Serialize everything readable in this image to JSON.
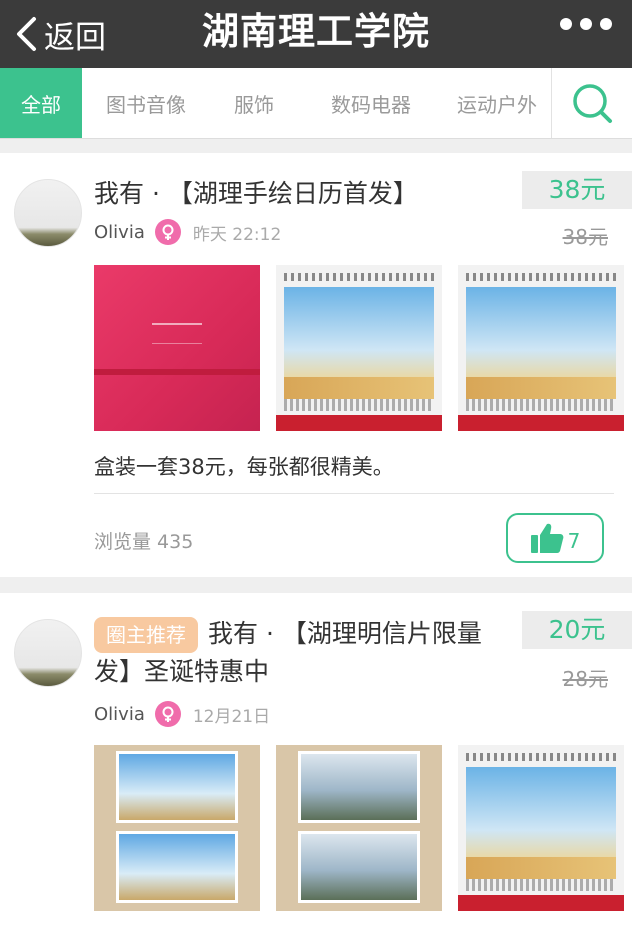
{
  "header": {
    "back_label": "返回",
    "title": "湖南理工学院"
  },
  "tabs": [
    {
      "label": "全部",
      "active": true
    },
    {
      "label": "图书音像"
    },
    {
      "label": "服饰"
    },
    {
      "label": "数码电器"
    },
    {
      "label": "运动户外"
    }
  ],
  "posts": [
    {
      "title": "我有 · 【湖理手绘日历首发】",
      "price": "38元",
      "original_price": "38元",
      "author": "Olivia",
      "time": "昨天 22:12",
      "description": "盒装一套38元，每张都很精美。",
      "views": "浏览量 435",
      "likes": "7"
    },
    {
      "tag": "圈主推荐",
      "title": "我有 · 【湖理明信片限量发】圣诞特惠中",
      "price": "20元",
      "original_price": "28元",
      "author": "Olivia",
      "time": "12月21日"
    }
  ],
  "colors": {
    "accent": "#3cc28e",
    "header_bg": "#3b3b3b",
    "female_badge": "#f06cab",
    "tag_bg": "#f8c9a0"
  }
}
